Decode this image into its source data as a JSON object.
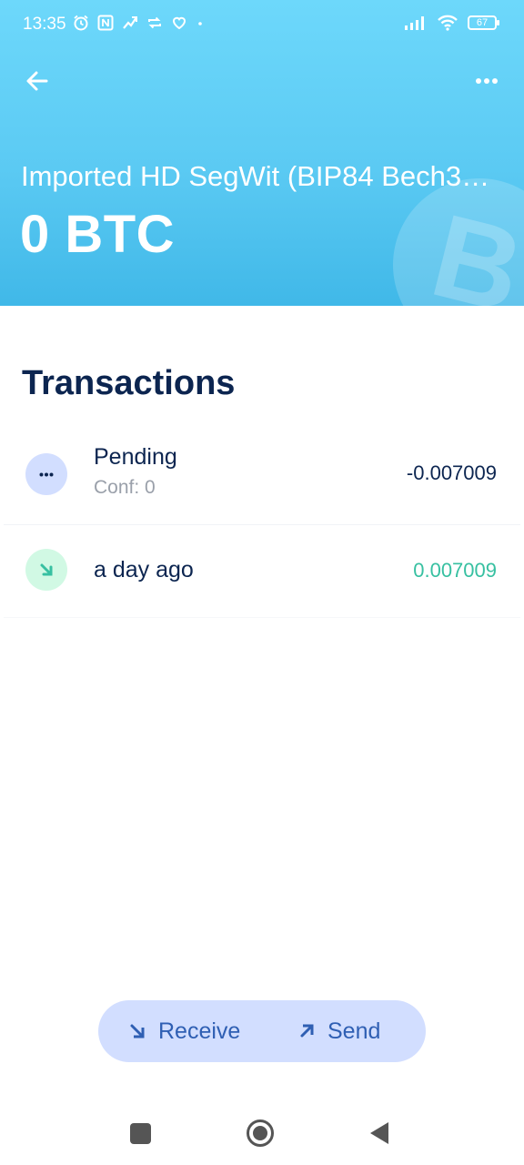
{
  "status_bar": {
    "time": "13:35",
    "battery_level": "67",
    "icons": [
      "alarm-icon",
      "nfc-icon",
      "app-notification-icon",
      "sync-icon",
      "heart-icon",
      "dot-icon",
      "signal-icon",
      "wifi-icon",
      "battery-icon"
    ]
  },
  "header": {
    "wallet_name": "Imported HD SegWit (BIP84 Bech3…",
    "balance": "0 BTC",
    "watermark_symbol": "B",
    "gradient_colors": [
      "#6dd8fb",
      "#40b8e8"
    ]
  },
  "transactions": {
    "title": "Transactions",
    "items": [
      {
        "label": "Pending",
        "sub": "Conf: 0",
        "amount": "-0.007009",
        "icon": "pending-dots-icon",
        "icon_symbol": "···"
      },
      {
        "label": "a day ago",
        "sub": "",
        "amount": "0.007009",
        "icon": "arrow-down-right-icon"
      }
    ]
  },
  "actions": {
    "receive_label": "Receive",
    "send_label": "Send"
  },
  "colors": {
    "title": "#0c2550",
    "incoming_amount": "#37c0a1",
    "action_text": "#2f5fb3",
    "action_bg": "#d2deff"
  }
}
